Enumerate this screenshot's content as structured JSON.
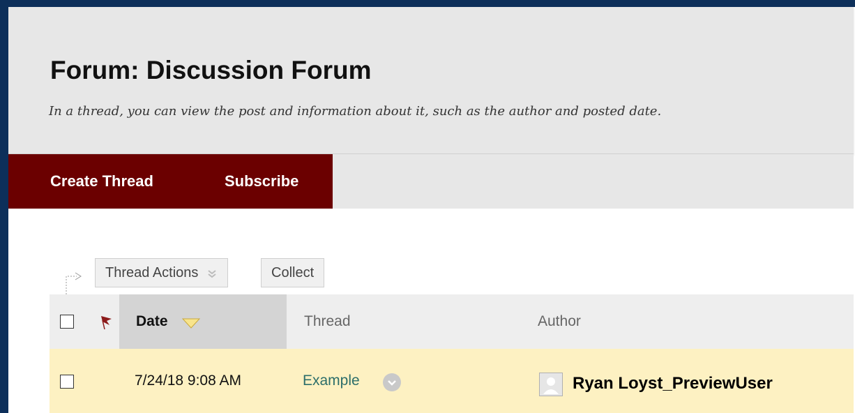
{
  "header": {
    "title": "Forum: Discussion Forum",
    "subtitle": "In a thread, you can view the post and information about it, such as the author and posted date."
  },
  "action_bar": {
    "items": [
      {
        "label": "Create Thread"
      },
      {
        "label": "Subscribe"
      }
    ]
  },
  "toolbar": {
    "thread_actions_label": "Thread Actions",
    "collect_label": "Collect"
  },
  "table": {
    "columns": {
      "date": "Date",
      "thread": "Thread",
      "author": "Author"
    },
    "sort": {
      "column": "date",
      "direction": "descending"
    },
    "rows": [
      {
        "date": "7/24/18 9:08 AM",
        "thread": "Example",
        "author": "Ryan Loyst_PreviewUser"
      }
    ]
  },
  "colors": {
    "accent": "#6b0000",
    "header_bg": "#e7e7e7",
    "row_highlight": "#fdf1c2",
    "link": "#2c6e6a",
    "frame": "#0d2f5a"
  },
  "icons": {
    "flag": "flag-icon",
    "sort": "sort-descending-icon",
    "menu": "chevron-down-circle-icon",
    "avatar": "user-avatar-icon"
  }
}
